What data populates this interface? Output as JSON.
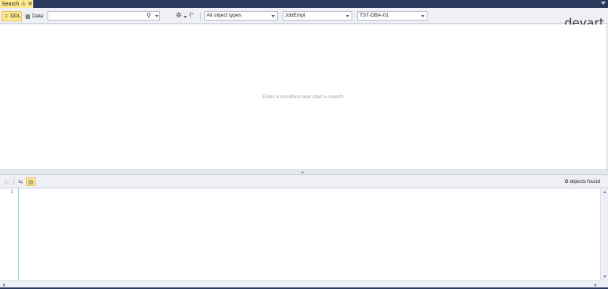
{
  "tab": {
    "title": "Search",
    "pin_icon": "pin-icon",
    "close_icon": "close-icon"
  },
  "toolbar": {
    "ddl_label": "DDL",
    "data_label": "Data",
    "search_value": "",
    "search_placeholder": "",
    "object_types": "All object types",
    "database": "JobEmpl",
    "server": "TST-DBA-01"
  },
  "logo": {
    "text": "devart"
  },
  "results": {
    "empty_message": "Enter a condition and start a search."
  },
  "bottom_toolbar": {
    "found_count": "0",
    "found_suffix": " objects found"
  },
  "editor": {
    "line_numbers": [
      "1"
    ],
    "text": ""
  },
  "colors": {
    "accent_tab": "#ffe98f",
    "frame": "#2b3a5c",
    "gutter_line": "#7ad6c9"
  }
}
